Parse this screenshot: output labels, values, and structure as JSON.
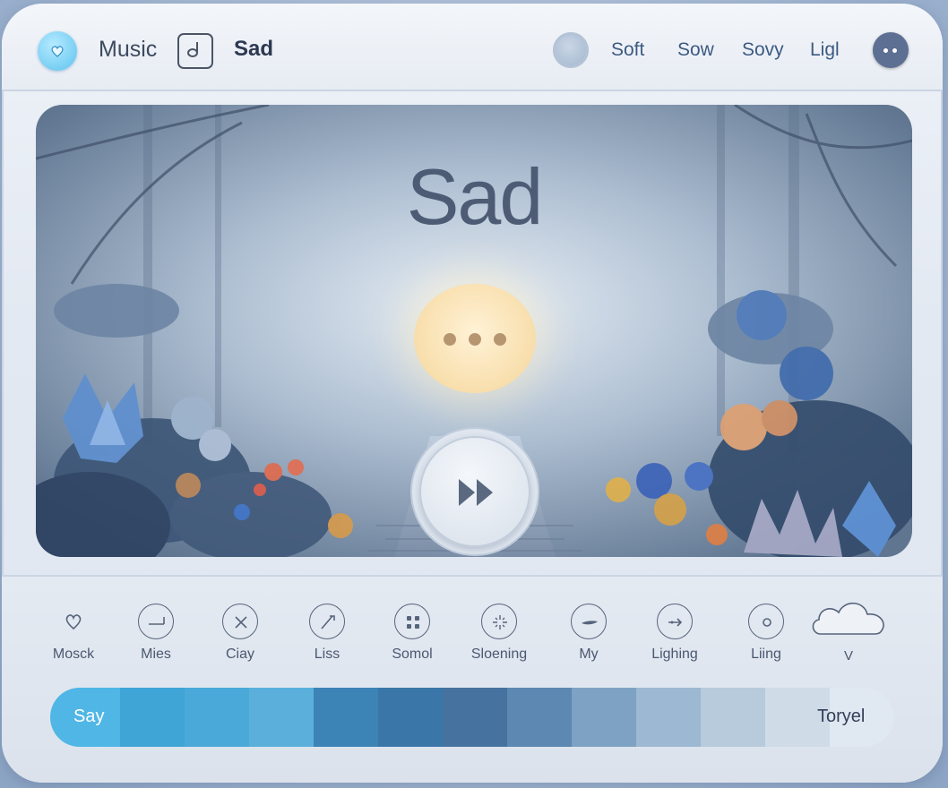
{
  "header": {
    "app_title": "Music",
    "mood_title": "Sad",
    "tabs": [
      "Soft",
      "Sow",
      "Sovy",
      "Ligl"
    ]
  },
  "scene": {
    "title": "Sad"
  },
  "controls": {
    "items": [
      {
        "label": "Mosck",
        "icon": "heart-icon"
      },
      {
        "label": "Mies",
        "icon": "line-icon"
      },
      {
        "label": "Ciay",
        "icon": "close-x-icon"
      },
      {
        "label": "Liss",
        "icon": "pen-icon"
      },
      {
        "label": "Somol",
        "icon": "grid-dots-icon"
      },
      {
        "label": "Sloening",
        "icon": "sparkle-icon"
      },
      {
        "label": "My",
        "icon": "dish-icon"
      },
      {
        "label": "Lighing",
        "icon": "arrow-lines-icon"
      },
      {
        "label": "Liing",
        "icon": "record-icon"
      }
    ],
    "cloud_label": "V"
  },
  "slider": {
    "start_label": "Say",
    "end_label": "Toryel",
    "colors": [
      "#3fa4d6",
      "#4aa9d8",
      "#5ab0db",
      "#3c83b6",
      "#3a77a8",
      "#45729f",
      "#5c88b2",
      "#7ea2c3",
      "#9db8d2",
      "#b8cbdc",
      "#cfdbe7",
      "#e0e8f1"
    ]
  },
  "colors": {
    "accent": "#4fb6e6",
    "menu": "#5d6f92",
    "orb": "#f8deac"
  }
}
